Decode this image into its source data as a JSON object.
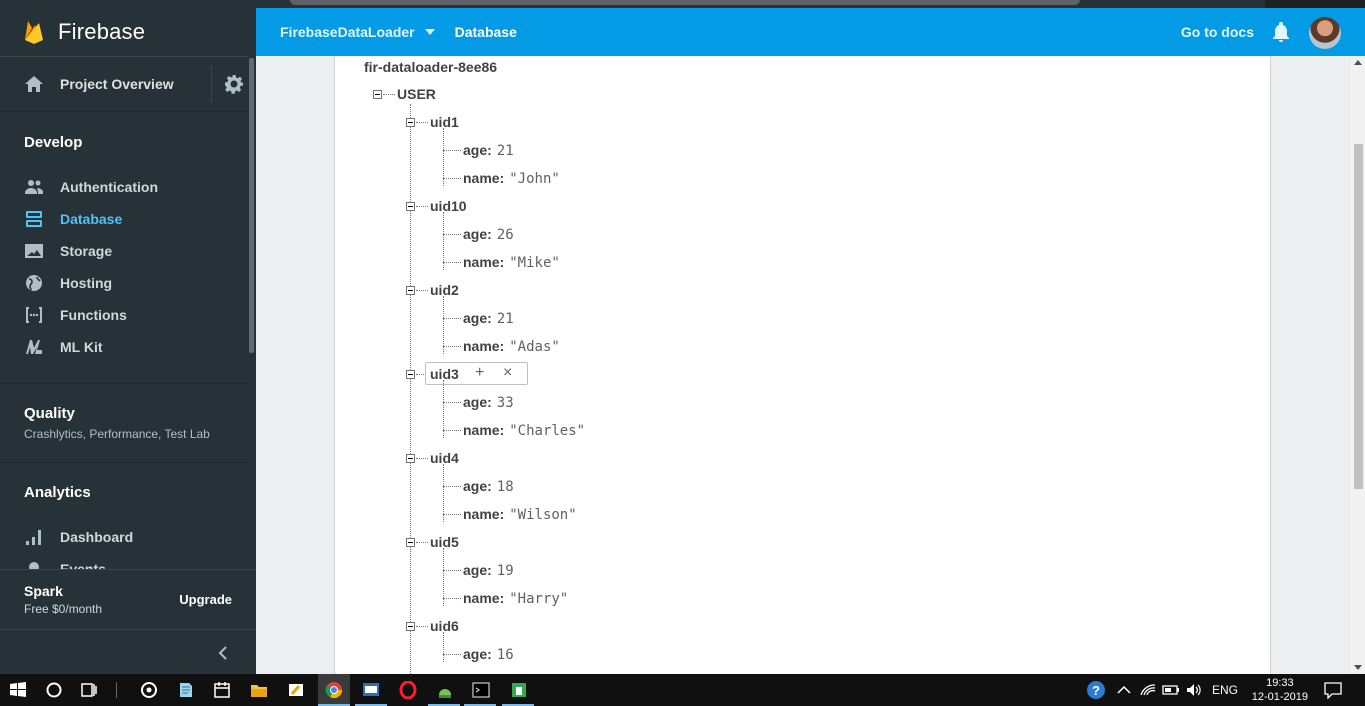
{
  "brand": {
    "name": "Firebase"
  },
  "sidebar": {
    "project_overview": "Project Overview",
    "develop": {
      "title": "Develop",
      "items": [
        {
          "label": "Authentication",
          "icon": "people-icon"
        },
        {
          "label": "Database",
          "icon": "database-icon",
          "active": true
        },
        {
          "label": "Storage",
          "icon": "image-icon"
        },
        {
          "label": "Hosting",
          "icon": "globe-icon"
        },
        {
          "label": "Functions",
          "icon": "functions-icon"
        },
        {
          "label": "ML Kit",
          "icon": "ml-kit-icon"
        }
      ]
    },
    "quality": {
      "title": "Quality",
      "subtitle": "Crashlytics, Performance, Test Lab"
    },
    "analytics": {
      "title": "Analytics",
      "items": [
        {
          "label": "Dashboard",
          "icon": "bar-chart-icon"
        },
        {
          "label": "Events",
          "icon": "pin-icon"
        }
      ]
    },
    "plan": {
      "name": "Spark",
      "price": "Free $0/month",
      "upgrade": "Upgrade"
    }
  },
  "header": {
    "project": "FirebaseDataLoader",
    "section": "Database",
    "docs": "Go to docs"
  },
  "database": {
    "root": "fir-dataloader-8ee86",
    "collection": "USER",
    "nodes": [
      {
        "key": "uid1",
        "age_key": "age:",
        "age": "21",
        "name_key": "name:",
        "name": "\"John\""
      },
      {
        "key": "uid10",
        "age_key": "age:",
        "age": "26",
        "name_key": "name:",
        "name": "\"Mike\""
      },
      {
        "key": "uid2",
        "age_key": "age:",
        "age": "21",
        "name_key": "name:",
        "name": "\"Adas\""
      },
      {
        "key": "uid3",
        "age_key": "age:",
        "age": "33",
        "name_key": "name:",
        "name": "\"Charles\"",
        "hovered": true
      },
      {
        "key": "uid4",
        "age_key": "age:",
        "age": "18",
        "name_key": "name:",
        "name": "\"Wilson\""
      },
      {
        "key": "uid5",
        "age_key": "age:",
        "age": "19",
        "name_key": "name:",
        "name": "\"Harry\""
      },
      {
        "key": "uid6",
        "age_key": "age:",
        "age": "16"
      }
    ],
    "hover_actions": {
      "add": "+",
      "remove": "×"
    }
  },
  "taskbar": {
    "lang": "ENG",
    "time": "19:33",
    "date": "12-01-2019"
  }
}
